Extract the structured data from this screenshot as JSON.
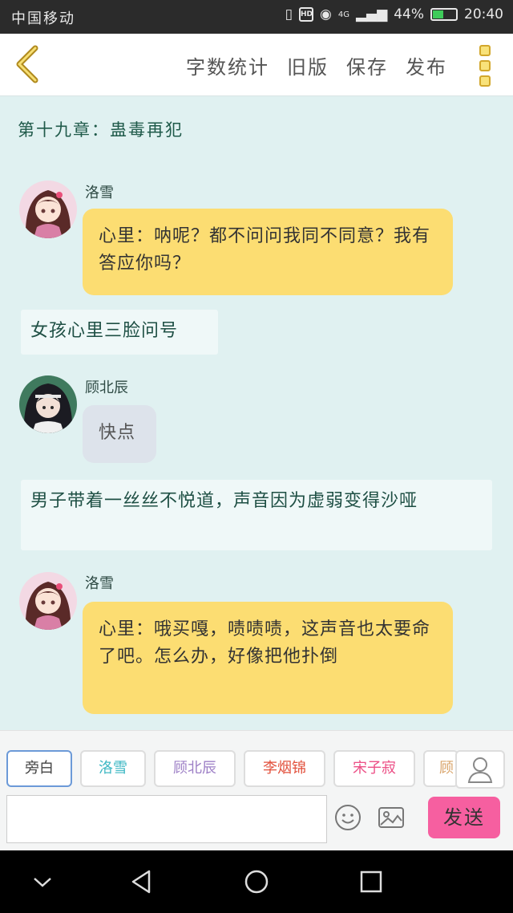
{
  "status": {
    "carrier": "中国移动",
    "hd": "HD",
    "network": "4G",
    "battery": "44%",
    "time": "20:40"
  },
  "toolbar": {
    "word_count": "字数统计",
    "old_version": "旧版",
    "save": "保存",
    "publish": "发布"
  },
  "chapter_title": "第十九章：蛊毒再犯",
  "messages": [
    {
      "speaker": "洛雪",
      "text": "心里：呐呢？都不问问我同不同意？我有答应你吗？"
    },
    {
      "narration": "女孩心里三脸问号"
    },
    {
      "speaker": "顾北辰",
      "text": "快点"
    },
    {
      "narration": "男子带着一丝丝不悦道，声音因为虚弱变得沙哑"
    },
    {
      "speaker": "洛雪",
      "text": "心里：哦买嘎，啧啧啧，这声音也太要命了吧。怎么办，好像把他扑倒"
    }
  ],
  "characters": [
    "旁白",
    "洛雪",
    "顾北辰",
    "李烟锦",
    "宋子寂",
    "顾"
  ],
  "character_colors": [
    "#444444",
    "#3fb8c4",
    "#9d7fc6",
    "#e2513d",
    "#ec4f86",
    "#d9a46a"
  ],
  "composer": {
    "placeholder": "",
    "send_label": "发送"
  }
}
